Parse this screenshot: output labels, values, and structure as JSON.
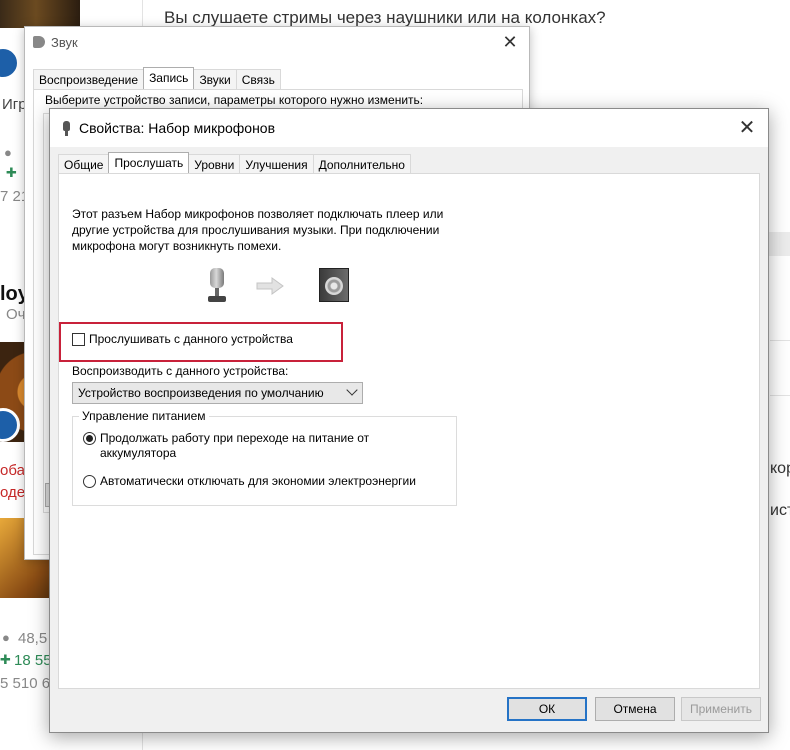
{
  "background": {
    "question": "Вы слушаете стримы через наушники или на колонках?",
    "left_texts": [
      "Игр",
      "7 21",
      "loy",
      "Оч",
      "оба",
      "одер",
      "48,5",
      "18 55",
      "5 510 6"
    ],
    "right_texts": [
      "кор",
      "ист"
    ]
  },
  "sound_dialog": {
    "title": "Звук",
    "tabs": [
      "Воспроизведение",
      "Запись",
      "Звуки",
      "Связь"
    ],
    "active_tab": "Запись",
    "hint": "Выберите устройство записи, параметры которого нужно изменить:"
  },
  "props_dialog": {
    "title": "Свойства: Набор микрофонов",
    "tabs": [
      "Общие",
      "Прослушать",
      "Уровни",
      "Улучшения",
      "Дополнительно"
    ],
    "active_tab": "Прослушать",
    "description": "Этот разъем Набор микрофонов позволяет подключать плеер или другие устройства для прослушивания музыки. При подключении микрофона могут возникнуть помехи.",
    "listen_checkbox": {
      "label": "Прослушивать с данного устройства",
      "checked": false
    },
    "playback_label": "Воспроизводить с данного устройства:",
    "playback_device": "Устройство воспроизведения по умолчанию",
    "power_group": {
      "title": "Управление питанием",
      "options": [
        {
          "label": "Продолжать работу при переходе на питание от аккумулятора",
          "selected": true
        },
        {
          "label": "Автоматически отключать для экономии электроэнергии",
          "selected": false
        }
      ]
    },
    "buttons": {
      "ok": "ОК",
      "cancel": "Отмена",
      "apply": "Применить"
    },
    "highlight_color": "#c8213a"
  }
}
